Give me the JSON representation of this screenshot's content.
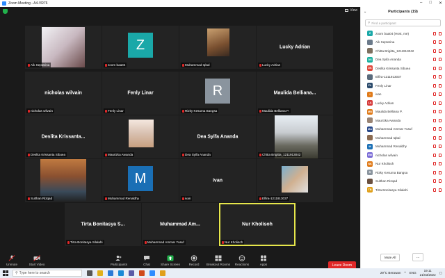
{
  "window": {
    "title": "Zoom Meeting - A4-VR76"
  },
  "view_label": "View",
  "tiles": [
    {
      "name": "Aik Septarina",
      "type": "photo"
    },
    {
      "name": "zoom baa04",
      "type": "avatar",
      "letter": "Z",
      "color": "#1aa8a8"
    },
    {
      "name": "Muhammad Iqbal",
      "type": "photo"
    },
    {
      "name": "Lucky Adrian",
      "type": "text",
      "display": "Lucky Adrian"
    },
    {
      "name": "nicholas wilvain",
      "type": "text",
      "display": "nicholas wilvain"
    },
    {
      "name": "Fenly Linar",
      "type": "text",
      "display": "Fenly Linar"
    },
    {
      "name": "Rizky Kesuma Bangsa",
      "type": "avatar",
      "letter": "R",
      "color": "#8a949e"
    },
    {
      "name": "Maulida Belliana P.",
      "type": "text",
      "display": "Maulida  Belliana..."
    },
    {
      "name": "Deslita Krissanta Sibuea",
      "type": "text",
      "display": "Deslita  Krissanta..."
    },
    {
      "name": "Maurizka Awanda",
      "type": "photo"
    },
    {
      "name": "Dea Syifa Ananda",
      "type": "text",
      "display": "Dea Syifa Ananda"
    },
    {
      "name": "Chitta Brigitta_1211913042",
      "type": "photo"
    },
    {
      "name": "Sulthan Rizqad",
      "type": "photo"
    },
    {
      "name": "Muhammad Renaldhy",
      "type": "avatar",
      "letter": "M",
      "color": "#1a6fb5"
    },
    {
      "name": "ivan",
      "type": "text",
      "display": "ivan"
    },
    {
      "name": "Elfira-1211913037",
      "type": "photo"
    },
    {
      "name": "Tirta Bonitasya Silalahi",
      "type": "text",
      "display": "Tirta  Bonitasya  S..."
    },
    {
      "name": "Muhammad Ammar Yusuf",
      "type": "text",
      "display": "Muhammad  Am..."
    },
    {
      "name": "Nur Kholisoh",
      "type": "text",
      "display": "Nur Kholisoh"
    }
  ],
  "toolbar": {
    "unmute": "Unmute",
    "start_video": "Start Video",
    "participants": "Participants",
    "participants_count": "19",
    "chat": "Chat",
    "share_screen": "Share Screen",
    "record": "Record",
    "breakout": "Breakout Rooms",
    "reactions": "Reactions",
    "apps": "Apps",
    "leave": "Leave Room"
  },
  "panel": {
    "title": "Participants (19)",
    "search_placeholder": "Find a participant",
    "mute_all": "Mute All",
    "more": "...",
    "participants": [
      {
        "initials": "Z",
        "name": "zoom baa04 (Host, me)",
        "color": "#1aa8a8"
      },
      {
        "initials": "",
        "name": "Aik Septarina",
        "color": "#6b7a8a"
      },
      {
        "initials": "",
        "name": "Chitta Brigitta_1211913042",
        "color": "#7d7060"
      },
      {
        "initials": "DS",
        "name": "Dea Syifa Ananda",
        "color": "#1ab0a0"
      },
      {
        "initials": "DK",
        "name": "Deslita Krissanta Sibuea",
        "color": "#e0473b"
      },
      {
        "initials": "",
        "name": "Elfira-1211913037",
        "color": "#5a6b7c"
      },
      {
        "initials": "FL",
        "name": "Fenly Linar",
        "color": "#2a4a6b"
      },
      {
        "initials": "I",
        "name": "ivan",
        "color": "#e07b1a"
      },
      {
        "initials": "LA",
        "name": "Lucky Adrian",
        "color": "#d63b3b"
      },
      {
        "initials": "MB",
        "name": "Maulida Belliana P.",
        "color": "#e07b1a"
      },
      {
        "initials": "",
        "name": "Maurizka Awanda",
        "color": "#9a8474"
      },
      {
        "initials": "MA",
        "name": "Muhammad Ammar Yusuf",
        "color": "#2a4a8a"
      },
      {
        "initials": "",
        "name": "Muhammad Iqbal",
        "color": "#8a6a50"
      },
      {
        "initials": "M",
        "name": "Muhammad Renaldhy",
        "color": "#1a6fb5"
      },
      {
        "initials": "NW",
        "name": "nicholas wilvain",
        "color": "#7a6bd6"
      },
      {
        "initials": "NK",
        "name": "Nur Kholisoh",
        "color": "#e07b1a"
      },
      {
        "initials": "R",
        "name": "Rizky Kesuma Bangsa",
        "color": "#8a949e"
      },
      {
        "initials": "",
        "name": "Sulthan Rizqad",
        "color": "#6a5040"
      },
      {
        "initials": "TB",
        "name": "Tirta Bonitasya Silalahi",
        "color": "#e0a01a"
      }
    ]
  },
  "taskbar": {
    "search_placeholder": "Type here to search",
    "weather": "29°C  Berawan",
    "lang": "ENG",
    "time": "19:11",
    "date": "21/03/2022"
  }
}
